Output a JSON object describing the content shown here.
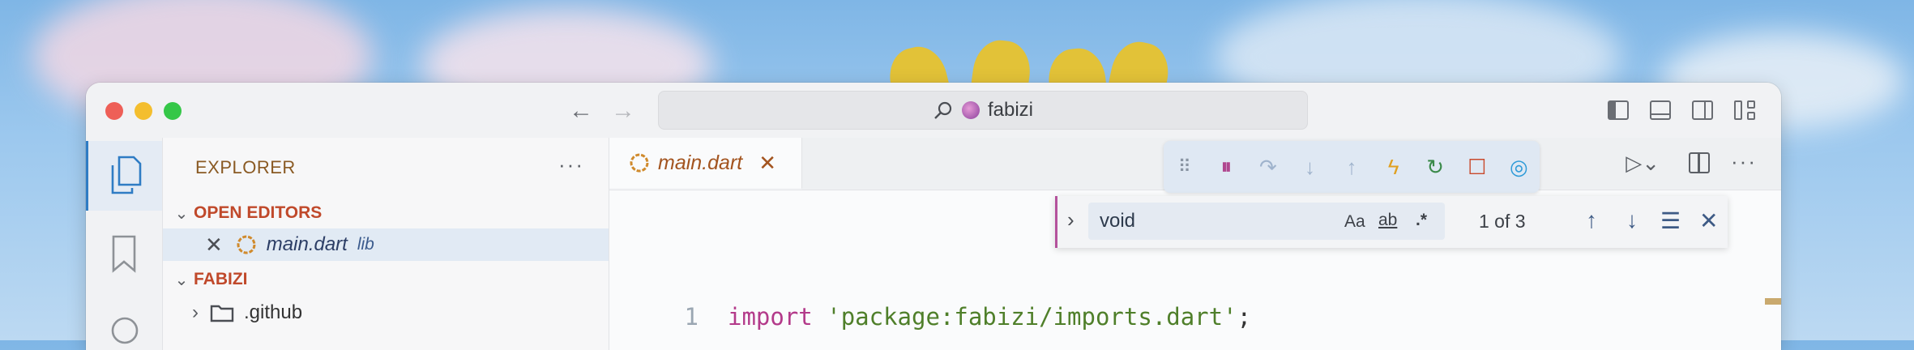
{
  "titlebar": {
    "back_icon": "arrow-left-icon",
    "forward_icon": "arrow-right-icon",
    "search_icon": "search-icon",
    "search_text": "fabizi"
  },
  "sidebar": {
    "title": "EXPLORER",
    "more": "···",
    "open_editors_label": "OPEN EDITORS",
    "open_editor_file": "main.dart",
    "open_editor_path": "lib",
    "project_label": "FABIZI",
    "folders": [
      ".github"
    ]
  },
  "editor": {
    "tab_label": "main.dart",
    "find": {
      "value": "void",
      "match_case_label": "Aa",
      "whole_word_label": "ab",
      "regex_label": ".*",
      "count": "1 of 3"
    },
    "code_lines": [
      {
        "number": "1",
        "keyword": "import",
        "string": "'package:fabizi/imports.dart'",
        "punct": ";"
      }
    ]
  },
  "colors": {
    "accent": "#2f7cc4",
    "tab_text": "#a3541f",
    "section_header": "#c0492b",
    "find_border": "#b4529c",
    "keyword": "#b33a8a",
    "string": "#4f7f2a"
  }
}
